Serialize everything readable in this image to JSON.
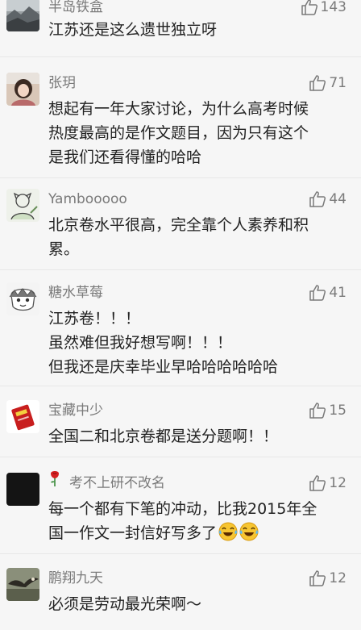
{
  "comments": [
    {
      "username": "半岛铁盒",
      "likes": "143",
      "lines": [
        "江苏还是这么遗世独立呀"
      ],
      "avatar_icon": "landscape-avatar-icon"
    },
    {
      "username": "张玥",
      "likes": "71",
      "lines": [
        "想起有一年大家讨论，为什么高考时候",
        "热度最高的是作文题目，因为只有这个",
        "是我们还看得懂的哈哈"
      ],
      "avatar_icon": "portrait-avatar-icon"
    },
    {
      "username": "Yambooooo",
      "likes": "44",
      "lines": [
        "北京卷水平很高，完全靠个人素养和积",
        "累。"
      ],
      "avatar_icon": "sketch-avatar-icon"
    },
    {
      "username": "糖水草莓",
      "likes": "41",
      "lines": [
        "江苏卷！！！",
        "虽然难但我好想写啊！！！",
        "但我还是庆幸毕业早哈哈哈哈哈哈"
      ],
      "avatar_icon": "cartoon-avatar-icon"
    },
    {
      "username": "宝藏中少",
      "likes": "15",
      "lines": [
        "全国二和北京卷都是送分题啊！！"
      ],
      "avatar_icon": "red-book-avatar-icon"
    },
    {
      "username": "考不上研不改名",
      "likes": "12",
      "lines": [
        "每一个都有下笔的冲动，比我2015年全",
        "国一作文一封信好写多了"
      ],
      "avatar_icon": "black-avatar-icon",
      "name_badge_icon": "rose-icon",
      "line_emoji_icon": "laughing-tears-emoji-icon",
      "line_emoji_count": 2
    },
    {
      "username": "鹏翔九天",
      "likes": "12",
      "lines": [
        "必须是劳动最光荣啊～"
      ],
      "avatar_icon": "eagle-avatar-icon"
    }
  ],
  "colors": {
    "background": "#f6f6f6",
    "username": "#7a7a7a",
    "text": "#222222",
    "divider": "#e7e7e7"
  },
  "like_icon": "thumbs-up-icon"
}
